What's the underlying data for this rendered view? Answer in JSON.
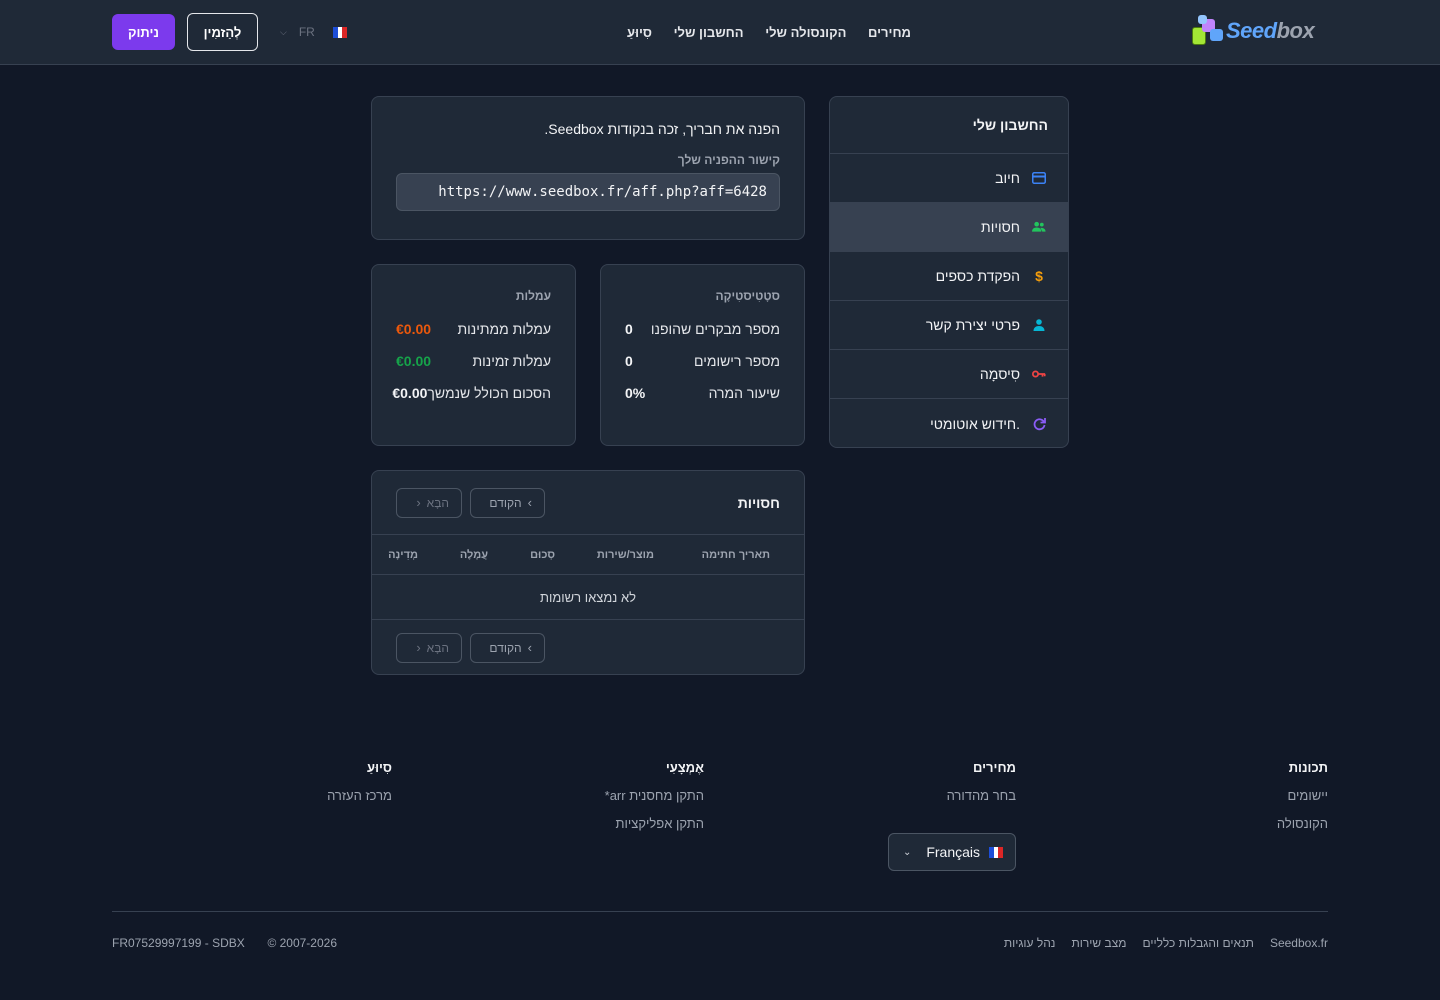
{
  "header": {
    "logo_text_a": "Seed",
    "logo_text_b": "box",
    "nav": [
      "מחירים",
      "הקונסולה שלי",
      "החשבון שלי",
      "סִיוּעַ"
    ],
    "lang_code": "FR",
    "invite_label": "לְהַזמִין",
    "logout_label": "ניתוק"
  },
  "sidebar": {
    "title": "החשבון שלי",
    "items": [
      {
        "label": "חיוב",
        "icon": "credit-card-icon",
        "color": "#3b82f6"
      },
      {
        "label": "חסויות",
        "icon": "users-icon",
        "color": "#22c55e",
        "active": true
      },
      {
        "label": "הפקדת כספים",
        "icon": "dollar-icon",
        "color": "#f59e0b"
      },
      {
        "label": "פרטי יצירת קשר",
        "icon": "user-icon",
        "color": "#06b6d4"
      },
      {
        "label": "סִיסמָה",
        "icon": "key-icon",
        "color": "#ef4444"
      },
      {
        "label": "חידוש אוטומטי.",
        "icon": "refresh-icon",
        "color": "#8b5cf6"
      }
    ]
  },
  "referral": {
    "intro": "הפנה את חבריך, זכה בנקודות Seedbox.",
    "label": "קישור ההפניה שלך",
    "link": "https://www.seedbox.fr/aff.php?aff=6428"
  },
  "stats": {
    "title": "סטָטִיסטִיקָה",
    "rows": [
      {
        "label": "מספר מבקרים שהופנו",
        "value": "0"
      },
      {
        "label": "מספר רישומים",
        "value": "0"
      },
      {
        "label": "שיעור המרה",
        "value": "0%"
      }
    ]
  },
  "commissions": {
    "title": "עמלות",
    "rows": [
      {
        "label": "עמלות ממתינות",
        "value": "€0.00"
      },
      {
        "label": "עמלות זמינות",
        "value": "€0.00"
      },
      {
        "label": "הסכום הכולל שנמשך",
        "value": "€0.00"
      }
    ]
  },
  "sponsorships": {
    "title": "חסויות",
    "prev_label": "הקודם",
    "next_label": "הבָּא",
    "columns": [
      "תאריך חתימה",
      "מוצר/שירות",
      "סְכוּם",
      "עֲמָלָה",
      "מְדִינָה"
    ],
    "empty": "לא נמצאו רשומות"
  },
  "footer": {
    "cols": [
      {
        "title": "תכונות",
        "links": [
          "יישומים",
          "הקונסולה"
        ]
      },
      {
        "title": "מחירים",
        "links": [
          "בחר מהדורה"
        ]
      },
      {
        "title": "אֶמְצָעִי",
        "links": [
          "התקן מחסנית arr*",
          "התקן אפליקציות"
        ]
      },
      {
        "title": "סִיוּעַ",
        "links": [
          "מרכז העזרה"
        ]
      }
    ],
    "language": "Français",
    "bottom_links": [
      "Seedbox.fr",
      "תנאים והגבלות כלליים",
      "מצב שירות",
      "נהל עוגיות"
    ],
    "copyright": "© 2007-2026",
    "company": "FR07529997199 - SDBX"
  }
}
